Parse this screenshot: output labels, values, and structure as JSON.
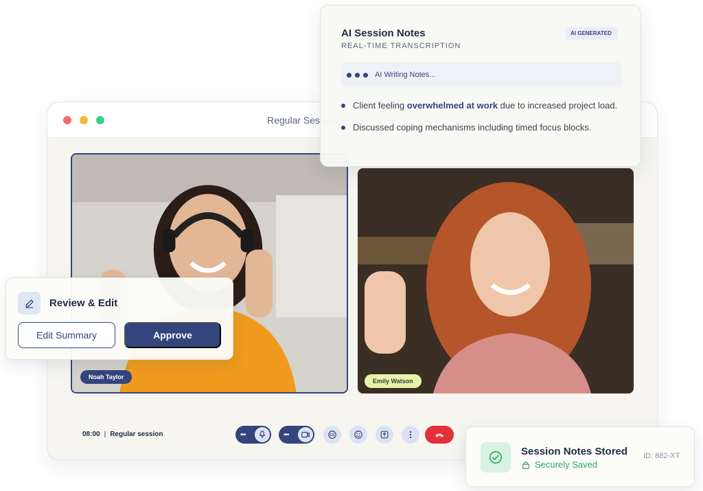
{
  "window": {
    "title": "Regular Session"
  },
  "participants": [
    {
      "name": "Noah Taylor"
    },
    {
      "name": "Emily Watson"
    }
  ],
  "session": {
    "time": "08:00",
    "separator": "|",
    "type": "Regular session"
  },
  "controls": {
    "more_glyph": "•••"
  },
  "ai_notes": {
    "title": "AI Session Notes",
    "subtitle": "REAL-TIME TRANSCRIPTION",
    "badge": "AI GENERATED",
    "status": "AI Writing Notes...",
    "bullets": [
      {
        "before": "Client feeling ",
        "highlight": "overwhelmed at work",
        "after": " due to increased project load."
      },
      {
        "before": "Discussed coping mechanisms including timed focus blocks.",
        "highlight": "",
        "after": ""
      }
    ]
  },
  "review": {
    "title": "Review & Edit",
    "edit_label": "Edit Summary",
    "approve_label": "Approve"
  },
  "stored": {
    "title": "Session Notes Stored",
    "subtitle": "Securely Saved",
    "id": "ID: 882-XT"
  },
  "colors": {
    "primary": "#34457d",
    "hangup": "#e3303b",
    "success": "#2aa764",
    "name_tag_emily": "#e6f2a8"
  },
  "icons": {
    "mic": "microphone-icon",
    "camera": "camera-icon",
    "captions": "captions-icon",
    "reactions": "emoji-icon",
    "share": "share-screen-icon",
    "more": "more-vertical-icon",
    "hangup": "phone-hangup-icon",
    "edit": "pencil-icon",
    "stored": "check-circle-icon",
    "lock": "lock-icon"
  }
}
